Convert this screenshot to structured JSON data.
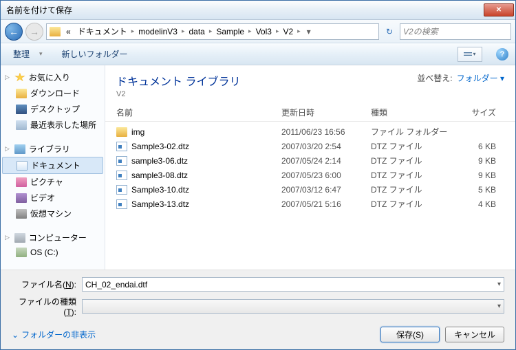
{
  "title": "名前を付けて保存",
  "breadcrumb": {
    "prefix": "«",
    "items": [
      "ドキュメント",
      "modelinV3",
      "data",
      "Sample",
      "Vol3",
      "V2"
    ]
  },
  "search_placeholder": "V2の検索",
  "toolbar": {
    "organize": "整理",
    "new_folder": "新しいフォルダー"
  },
  "nav": {
    "favorites": "お気に入り",
    "downloads": "ダウンロード",
    "desktop": "デスクトップ",
    "recent": "最近表示した場所",
    "libraries": "ライブラリ",
    "documents": "ドキュメント",
    "pictures": "ピクチャ",
    "videos": "ビデオ",
    "vm": "仮想マシン",
    "computer": "コンピューター",
    "osc": "OS (C:)"
  },
  "library": {
    "title": "ドキュメント ライブラリ",
    "subtitle": "V2",
    "sort_label": "並べ替え:",
    "sort_value": "フォルダー"
  },
  "columns": {
    "name": "名前",
    "date": "更新日時",
    "type": "種類",
    "size": "サイズ"
  },
  "files": [
    {
      "name": "img",
      "date": "2011/06/23 16:56",
      "type": "ファイル フォルダー",
      "size": "",
      "icon": "folder"
    },
    {
      "name": "Sample3-02.dtz",
      "date": "2007/03/20 2:54",
      "type": "DTZ ファイル",
      "size": "6 KB",
      "icon": "dtz"
    },
    {
      "name": "sample3-06.dtz",
      "date": "2007/05/24 2:14",
      "type": "DTZ ファイル",
      "size": "9 KB",
      "icon": "dtz"
    },
    {
      "name": "sample3-08.dtz",
      "date": "2007/05/23 6:00",
      "type": "DTZ ファイル",
      "size": "9 KB",
      "icon": "dtz"
    },
    {
      "name": "Sample3-10.dtz",
      "date": "2007/03/12 6:47",
      "type": "DTZ ファイル",
      "size": "5 KB",
      "icon": "dtz"
    },
    {
      "name": "Sample3-13.dtz",
      "date": "2007/05/21 5:16",
      "type": "DTZ ファイル",
      "size": "4 KB",
      "icon": "dtz"
    }
  ],
  "filename_label_pre": "ファイル名(",
  "filename_label_key": "N",
  "filename_label_post": "):",
  "filetype_label_pre": "ファイルの種類(",
  "filetype_label_key": "T",
  "filetype_label_post": "):",
  "filename_value": "CH_02_endai.dtf",
  "filetype_value": "",
  "hide_folders": "フォルダーの非表示",
  "save_btn": "保存(S)",
  "cancel_btn": "キャンセル"
}
